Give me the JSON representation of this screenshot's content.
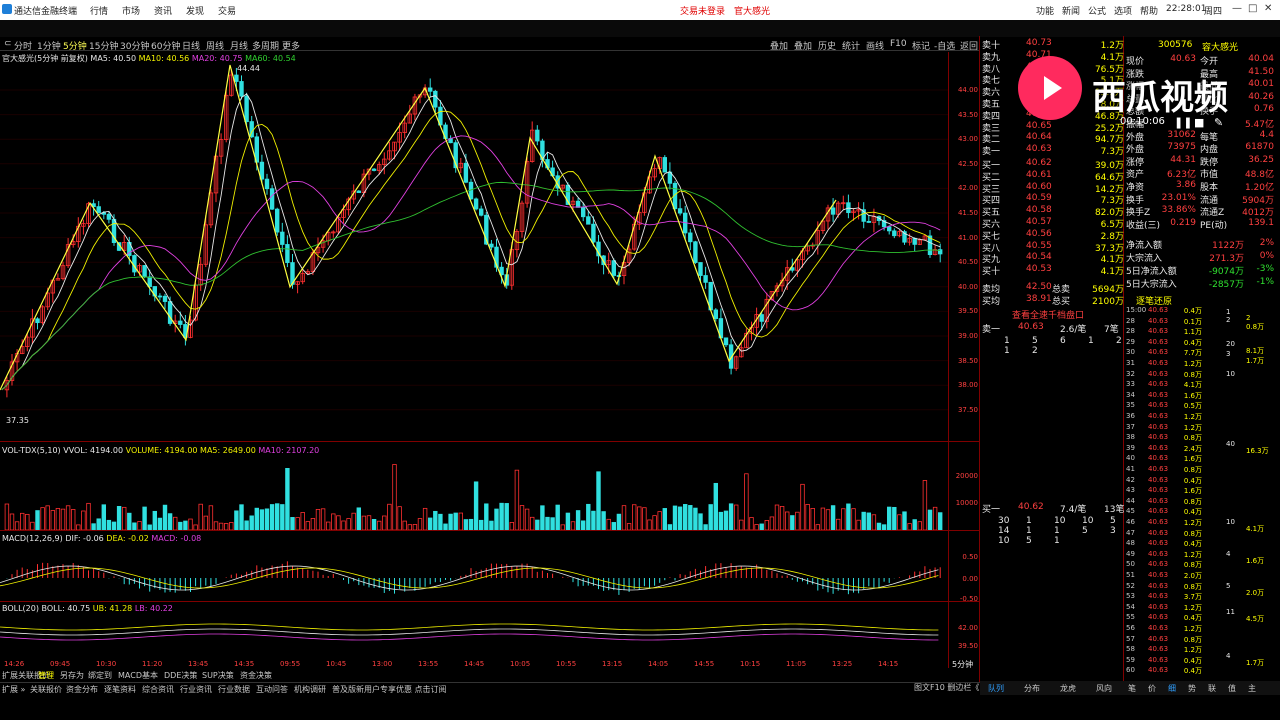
{
  "window": {
    "app_title": "通达信金融终端",
    "menus": [
      "行情",
      "市场",
      "资讯",
      "发现",
      "交易"
    ],
    "status_left": "交易未登录",
    "status_right": "官大感光",
    "right_menus": [
      "功能",
      "新闻",
      "公式",
      "选项",
      "帮助"
    ],
    "clock": "22:28:01",
    "weekday": "周四"
  },
  "toolbar": {
    "periods": [
      "分时",
      "1分钟",
      "5分钟",
      "15分钟",
      "30分钟",
      "60分钟",
      "日线",
      "周线",
      "月线",
      "多周期",
      "更多"
    ],
    "active_period": "5分钟",
    "tools": [
      "叠加",
      "叠加",
      "历史",
      "统计",
      "画线",
      "F10",
      "标记",
      "-自选",
      "返回"
    ]
  },
  "chart_header": {
    "name": "官大感光(5分钟 前复权)",
    "ma5": "MA5: 40.50",
    "ma10": "MA10: 40.56",
    "ma20": "MA20: 40.75",
    "ma60": "MA60: 40.54",
    "high_label": "44.44",
    "low_label": "37.35"
  },
  "price_axis": [
    "44.00",
    "43.50",
    "43.00",
    "42.50",
    "42.00",
    "41.50",
    "41.00",
    "40.50",
    "40.00",
    "39.50",
    "39.00",
    "38.50",
    "38.00",
    "37.50"
  ],
  "volume_header": {
    "name": "VOL-TDX(5,10)",
    "vvol": "VVOL: 4194.00",
    "volume": "VOLUME: 4194.00",
    "ma5": "MA5: 2649.00",
    "ma10": "MA10: 2107.20"
  },
  "volume_axis": [
    "20000",
    "10000"
  ],
  "macd_header": {
    "name": "MACD(12,26,9)",
    "dif": "DIF: -0.06",
    "dea": "DEA: -0.02",
    "macd": "MACD: -0.08"
  },
  "macd_axis": [
    "0.50",
    "0.00",
    "-0.50"
  ],
  "boll_header": {
    "name": "BOLL(20)",
    "boll": "BOLL: 40.75",
    "ub": "UB: 41.28",
    "lb": "LB: 40.22"
  },
  "boll_axis": [
    "42.00",
    "39.50"
  ],
  "time_axis": [
    "14:26",
    "09:45",
    "10:30",
    "11:20",
    "13:45",
    "14:35",
    "09:55",
    "10:45",
    "13:00",
    "13:55",
    "14:45",
    "10:05",
    "10:55",
    "13:15",
    "14:05",
    "14:55",
    "10:15",
    "11:05",
    "13:25",
    "14:15"
  ],
  "period_label": "5分钟",
  "order_book": {
    "asks": [
      {
        "label": "卖十",
        "price": "40.73",
        "vol": "1.2万"
      },
      {
        "label": "卖九",
        "price": "40.71",
        "vol": "4.1万"
      },
      {
        "label": "卖八",
        "price": "40.70",
        "vol": "76.5万"
      },
      {
        "label": "卖七",
        "price": "40.69",
        "vol": "5.1万"
      },
      {
        "label": "卖六",
        "price": "40.68",
        "vol": "15.9万"
      },
      {
        "label": "卖五",
        "price": "40.67",
        "vol": "8.0万"
      },
      {
        "label": "卖四",
        "price": "40.66",
        "vol": "46.8万"
      },
      {
        "label": "卖三",
        "price": "40.65",
        "vol": "25.2万"
      },
      {
        "label": "卖二",
        "price": "40.64",
        "vol": "94.7万"
      },
      {
        "label": "卖一",
        "price": "40.63",
        "vol": "7.3万"
      }
    ],
    "bids": [
      {
        "label": "买一",
        "price": "40.62",
        "vol": "39.0万"
      },
      {
        "label": "买二",
        "price": "40.61",
        "vol": "64.6万"
      },
      {
        "label": "买三",
        "price": "40.60",
        "vol": "14.2万"
      },
      {
        "label": "买四",
        "price": "40.59",
        "vol": "7.3万"
      },
      {
        "label": "买五",
        "price": "40.58",
        "vol": "82.0万"
      },
      {
        "label": "买六",
        "price": "40.57",
        "vol": "6.5万"
      },
      {
        "label": "买七",
        "price": "40.56",
        "vol": "2.8万"
      },
      {
        "label": "买八",
        "price": "40.55",
        "vol": "37.3万"
      },
      {
        "label": "买九",
        "price": "40.54",
        "vol": "4.1万"
      },
      {
        "label": "买十",
        "price": "40.53",
        "vol": "4.1万"
      }
    ],
    "avg_sell": {
      "label": "卖均",
      "price": "42.50",
      "tot_label": "总卖",
      "tot": "5694万"
    },
    "avg_buy": {
      "label": "买均",
      "price": "38.91",
      "tot_label": "总买",
      "tot": "2100万"
    },
    "link": "查看全速千档盘口",
    "sell1_detail": {
      "label": "卖一",
      "price": "40.63",
      "count": "2.6/笔",
      "num": "7笔",
      "q1": [
        "1",
        "5",
        "6",
        "1",
        "2"
      ],
      "q2": [
        "1",
        "2"
      ]
    },
    "buy1_detail": {
      "label": "买一",
      "price": "40.62",
      "count": "7.4/笔",
      "num": "13笔",
      "q1": [
        "30",
        "1",
        "10",
        "10",
        "5"
      ],
      "q2": [
        "14",
        "1",
        "1",
        "5",
        "3"
      ],
      "q3": [
        "10",
        "5",
        "1"
      ]
    }
  },
  "quote": {
    "code": "300576",
    "name": "容大感光",
    "rows": [
      {
        "k1": "现价",
        "v1": "40.63",
        "k2": "今开",
        "v2": "40.04"
      },
      {
        "k1": "涨跌",
        "v1": "",
        "k2": "最高",
        "v2": "41.50"
      },
      {
        "k1": "涨幅",
        "v1": "",
        "k2": "最低",
        "v2": "40.01"
      },
      {
        "k1": "总量",
        "v1": "",
        "k2": "量比",
        "v2": "40.26"
      },
      {
        "k1": "总额",
        "v1": "",
        "k2": "换手",
        "v2": "0.76"
      },
      {
        "k1": "振幅",
        "v1": "",
        "k2": "",
        "v2": "5.47亿"
      },
      {
        "k1": "外盘",
        "v1": "31062",
        "k2": "每笔",
        "v2": "4.4"
      },
      {
        "k1": "外盘",
        "v1": "73975",
        "k2": "内盘",
        "v2": "61870"
      },
      {
        "k1": "涨停",
        "v1": "44.31",
        "k2": "跌停",
        "v2": "36.25"
      },
      {
        "k1": "资产",
        "v1": "6.23亿",
        "k2": "市值",
        "v2": "48.8亿"
      },
      {
        "k1": "净资",
        "v1": "3.86",
        "k2": "股本",
        "v2": "1.20亿"
      },
      {
        "k1": "换手",
        "v1": "23.01%",
        "k2": "流通",
        "v2": "5904万"
      },
      {
        "k1": "换手Z",
        "v1": "33.86%",
        "k2": "流通Z",
        "v2": "4012万"
      },
      {
        "k1": "收益(三)",
        "v1": "0.219",
        "k2": "PE(动)",
        "v2": "139.1"
      }
    ],
    "flows": [
      {
        "k": "净流入额",
        "v": "1122万",
        "p": "2%"
      },
      {
        "k": "大宗流入",
        "v": "271.3万",
        "p": "0%"
      },
      {
        "k": "5日净流入额",
        "v": "-9074万",
        "p": "-3%"
      },
      {
        "k": "5日大宗流入",
        "v": "-2857万",
        "p": "-1%"
      }
    ]
  },
  "ticks": {
    "title": "逐笔还原",
    "rows": [
      [
        "15:00",
        "40.63",
        "0.4万"
      ],
      [
        "28",
        "40.63",
        "0.1万"
      ],
      [
        "28",
        "40.63",
        "1.1万"
      ],
      [
        "29",
        "40.63",
        "0.4万"
      ],
      [
        "30",
        "40.63",
        "7.7万"
      ],
      [
        "31",
        "40.63",
        "1.2万"
      ],
      [
        "32",
        "40.63",
        "0.8万"
      ],
      [
        "33",
        "40.63",
        "4.1万"
      ],
      [
        "34",
        "40.63",
        "1.6万"
      ],
      [
        "35",
        "40.63",
        "0.5万"
      ],
      [
        "36",
        "40.63",
        "1.2万"
      ],
      [
        "37",
        "40.63",
        "1.2万"
      ],
      [
        "38",
        "40.63",
        "0.8万"
      ],
      [
        "39",
        "40.63",
        "2.4万"
      ],
      [
        "40",
        "40.63",
        "1.6万"
      ],
      [
        "41",
        "40.63",
        "0.8万"
      ],
      [
        "42",
        "40.63",
        "0.4万"
      ],
      [
        "43",
        "40.63",
        "1.6万"
      ],
      [
        "44",
        "40.63",
        "0.8万"
      ],
      [
        "45",
        "40.63",
        "0.4万"
      ],
      [
        "46",
        "40.63",
        "1.2万"
      ],
      [
        "47",
        "40.63",
        "0.8万"
      ],
      [
        "48",
        "40.63",
        "0.4万"
      ],
      [
        "49",
        "40.63",
        "1.2万"
      ],
      [
        "50",
        "40.63",
        "0.8万"
      ],
      [
        "51",
        "40.63",
        "2.0万"
      ],
      [
        "52",
        "40.63",
        "0.8万"
      ],
      [
        "53",
        "40.63",
        "3.7万"
      ],
      [
        "54",
        "40.63",
        "1.2万"
      ],
      [
        "55",
        "40.63",
        "0.4万"
      ],
      [
        "56",
        "40.63",
        "1.2万"
      ],
      [
        "57",
        "40.63",
        "0.8万"
      ],
      [
        "58",
        "40.63",
        "1.2万"
      ],
      [
        "59",
        "40.63",
        "0.4万"
      ],
      [
        "60",
        "40.63",
        "0.4万"
      ]
    ],
    "side": [
      {
        "a": "1",
        "b": "2"
      },
      {
        "a": "2",
        "b": "0.8万"
      },
      {
        "a": "20",
        "b": "8.1万"
      },
      {
        "a": "3",
        "b": "1.7万"
      },
      {
        "a": "10",
        "b": ""
      },
      {
        "a": "40",
        "b": "16.3万"
      },
      {
        "a": "10",
        "b": "4.1万"
      },
      {
        "a": "4",
        "b": "1.6万"
      },
      {
        "a": "5",
        "b": "2.0万"
      },
      {
        "a": "11",
        "b": "4.5万"
      },
      {
        "a": "4",
        "b": "1.7万"
      }
    ]
  },
  "bottom_tabs": [
    "扩展",
    "关联报价",
    "管理",
    "另存为",
    "绑定到",
    "MACD基本",
    "DDE决策",
    "SUP决策",
    "资金决策"
  ],
  "bottom_active": "管理",
  "bottom_more": [
    "扩展 »",
    "关联报价",
    "资金分布",
    "逐笔资料",
    "综合资讯",
    "行业资讯",
    "行业数据",
    "互动问答",
    "机构调研",
    "普及版新用户专享优惠 点击订阅"
  ],
  "right_bottom_tabs": [
    "队列",
    "分布",
    "龙虎",
    "风向",
    "笔",
    "价",
    "细",
    "势",
    "联",
    "值",
    "主"
  ],
  "right_bottom_info": "图文F10 删边栏《",
  "overlay": {
    "brand": "西瓜视频",
    "time": "00:10:06"
  }
}
